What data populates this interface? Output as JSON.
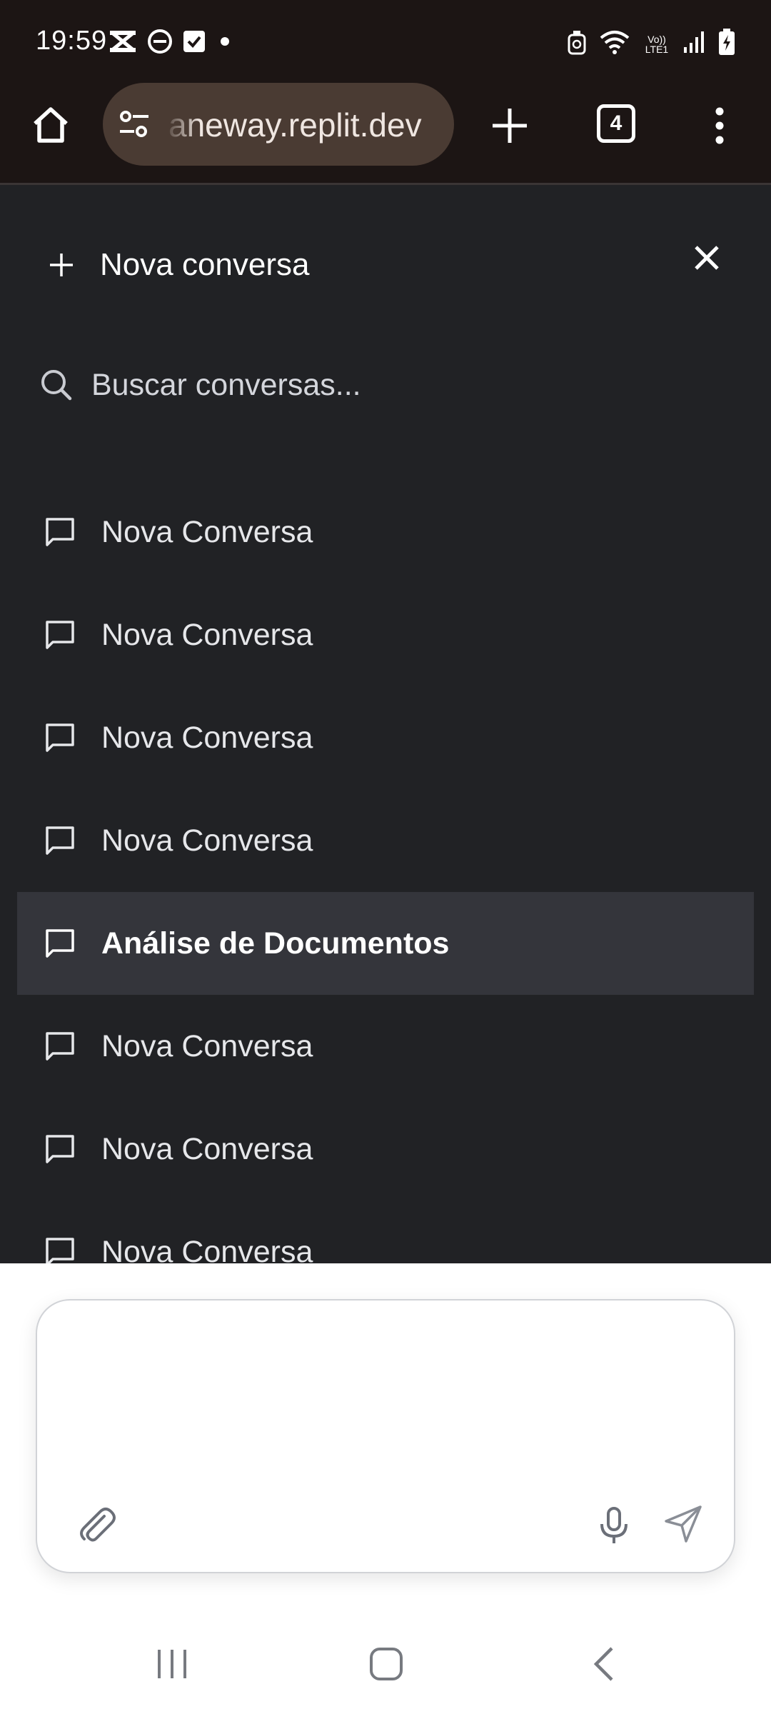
{
  "status_bar": {
    "time": "19:59",
    "left_icons": [
      "capcut-icon",
      "dnd-icon",
      "check-icon",
      "dot-icon"
    ],
    "right_icons": [
      "alarm-icon",
      "wifi-icon",
      "volte-icon",
      "signal-icon",
      "battery-icon"
    ],
    "volte_text": "Vo)) LTE1"
  },
  "browser": {
    "url": "aneway.replit.dev",
    "tab_count": "4"
  },
  "sidebar": {
    "new_conversation_label": "Nova conversa",
    "search_placeholder": "Buscar conversas...",
    "conversations": [
      {
        "title": "Nova Conversa",
        "active": false
      },
      {
        "title": "Nova Conversa",
        "active": false
      },
      {
        "title": "Nova Conversa",
        "active": false
      },
      {
        "title": "Nova Conversa",
        "active": false
      },
      {
        "title": "Análise de Documentos",
        "active": true
      },
      {
        "title": "Nova Conversa",
        "active": false
      },
      {
        "title": "Nova Conversa",
        "active": false
      },
      {
        "title": "Nova Conversa",
        "active": false
      }
    ]
  },
  "composer": {
    "value": ""
  },
  "colors": {
    "browser_bg": "#1c1514",
    "url_pill": "#4a3b33",
    "sidebar_bg": "#212225",
    "active_item_bg": "#34353b"
  }
}
